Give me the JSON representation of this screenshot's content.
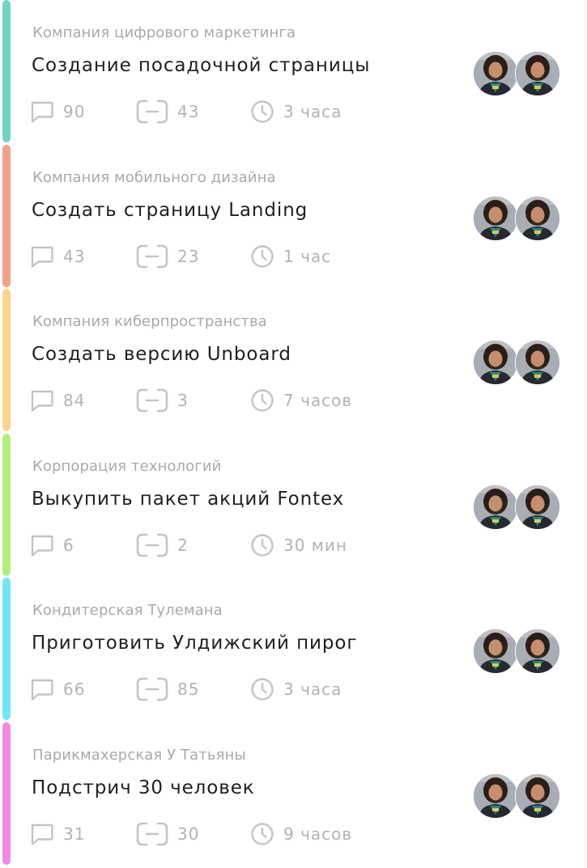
{
  "tasks": [
    {
      "company": "Компания цифрового маркетинга",
      "title": "Создание посадочной страницы",
      "comments": "90",
      "subtasks": "43",
      "time": "3 часа",
      "accent_color": "#6fd4c5"
    },
    {
      "company": "Компания мобильного дизайна",
      "title": "Создать страницу Landing",
      "comments": "43",
      "subtasks": "23",
      "time": "1 час",
      "accent_color": "#f7a08a"
    },
    {
      "company": "Компания киберпространства",
      "title": "Создать версию Unboard",
      "comments": "84",
      "subtasks": "3",
      "time": "7 часов",
      "accent_color": "#fdd58a"
    },
    {
      "company": "Корпорация технологий",
      "title": "Выкупить пакет акций Fontex",
      "comments": "6",
      "subtasks": "2",
      "time": "30 мин",
      "accent_color": "#b0f07a"
    },
    {
      "company": "Кондитерская Тулемана",
      "title": "Приготовить Улдижский пирог",
      "comments": "66",
      "subtasks": "85",
      "time": "3 часа",
      "accent_color": "#6ee8f7"
    },
    {
      "company": "Парикмахерская У Татьяны",
      "title": "Подстрич 30 человек",
      "comments": "31",
      "subtasks": "30",
      "time": "9 часов",
      "accent_color": "#f48adf"
    }
  ],
  "icons": {
    "comments": "comment-icon",
    "subtasks": "subtasks-icon",
    "time": "clock-icon",
    "assignee": "avatar"
  },
  "colors": {
    "muted_text": "#a9a9a9",
    "title_text": "#1f1f1f",
    "icon_stroke": "#c4c4c4"
  }
}
